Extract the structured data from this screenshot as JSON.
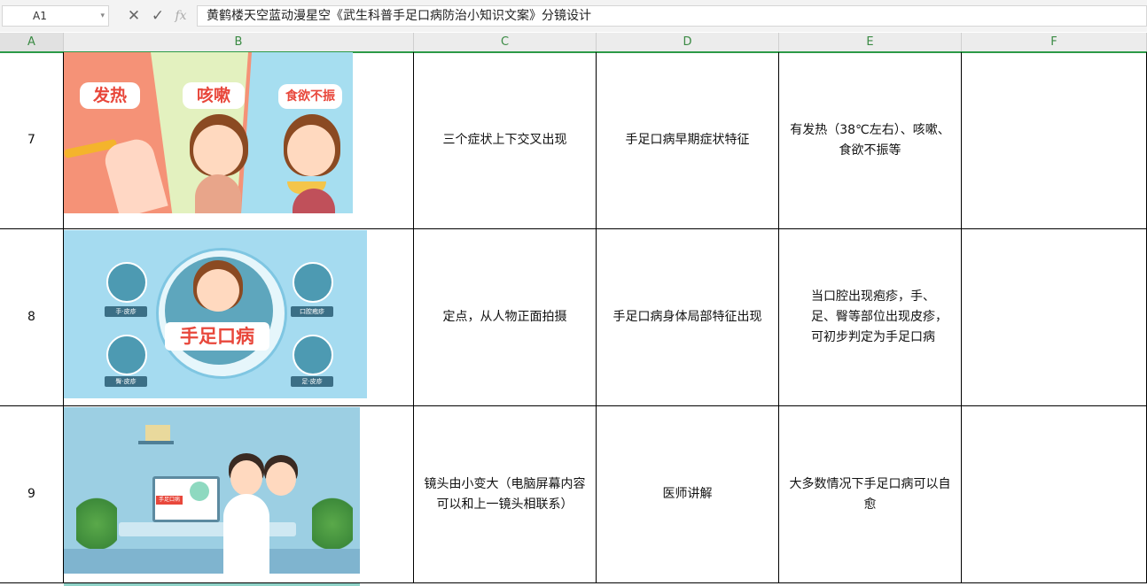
{
  "formula_bar": {
    "cell_ref": "A1",
    "fx_label": "fx",
    "content": "黄鹤楼天空蓝动漫星空《武生科普手足口病防治小知识文案》分镜设计"
  },
  "columns": [
    "A",
    "B",
    "C",
    "D",
    "E",
    "F"
  ],
  "rows": [
    {
      "num": "7",
      "shot": "三个症状上下交叉出现",
      "content": "手足口病早期症状特征",
      "voiceover": "有发热（38℃左右）、咳嗽、食欲不振等",
      "image_labels": [
        "发热",
        "咳嗽",
        "食欲不振"
      ]
    },
    {
      "num": "8",
      "shot": "定点，从人物正面拍摄",
      "content": "手足口病身体局部特征出现",
      "voiceover": "当口腔出现疱疹，手、足、臀等部位出现皮疹，可初步判定为手足口病",
      "image_labels": [
        "手足口病",
        "手·皮疹",
        "口腔疱疹",
        "臀·皮疹",
        "足·皮疹"
      ]
    },
    {
      "num": "9",
      "shot": "镜头由小变大（电脑屏幕内容可以和上一镜头相联系）",
      "content": "医师讲解",
      "voiceover": "大多数情况下手足口病可以自愈",
      "image_labels": [
        "手足口病"
      ]
    }
  ],
  "colors": {
    "header_green": "#3a8a43",
    "accent_red": "#e8473b",
    "panel_orange": "#f59277",
    "panel_green": "#e3f1bf",
    "panel_blue": "#a6def0"
  }
}
